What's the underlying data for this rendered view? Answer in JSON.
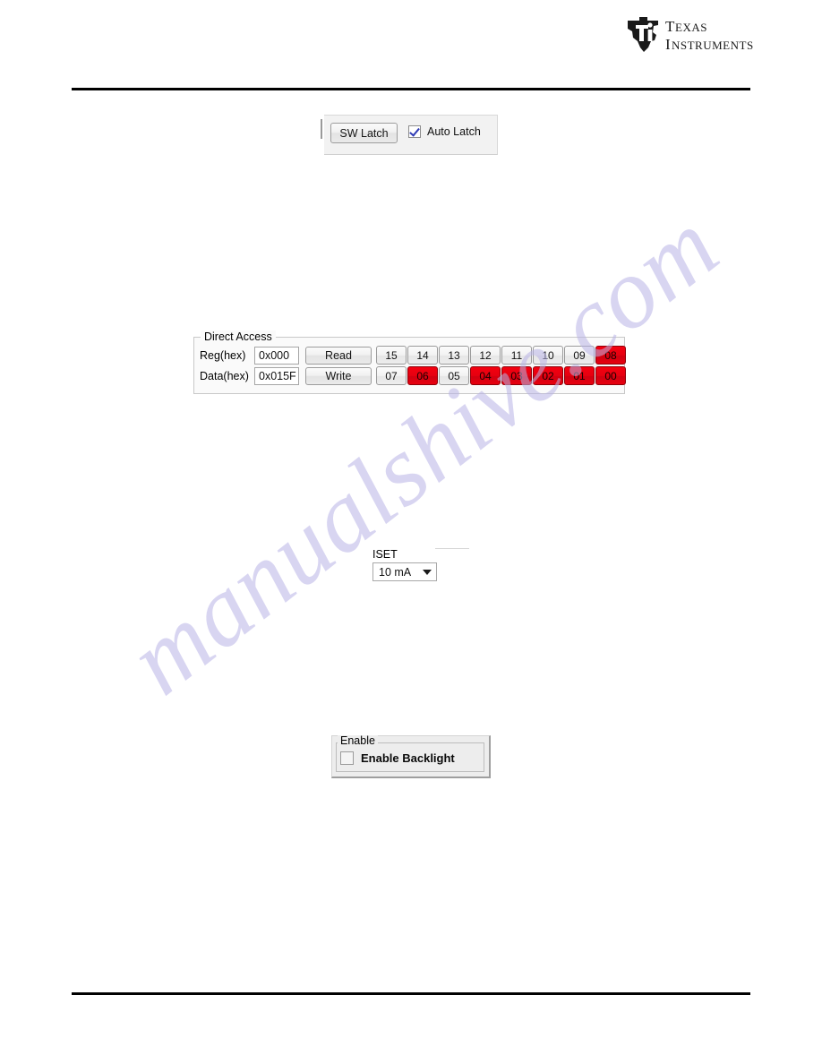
{
  "document": {
    "brand": {
      "logo_name": "texas-instruments-logo",
      "line1": "TEXAS",
      "line2": "INSTRUMENTS"
    },
    "watermark": "manualshive.com"
  },
  "latch_panel": {
    "sw_latch_button": "SW Latch",
    "auto_latch_label": "Auto Latch",
    "auto_latch_checked": true
  },
  "direct_access": {
    "title": "Direct Access",
    "reg_label": "Reg(hex)",
    "reg_value": "0x000",
    "data_label": "Data(hex)",
    "data_value": "0x015F",
    "read_button": "Read",
    "write_button": "Write",
    "bits": [
      {
        "label": "15",
        "state": "off"
      },
      {
        "label": "14",
        "state": "off"
      },
      {
        "label": "13",
        "state": "off"
      },
      {
        "label": "12",
        "state": "off"
      },
      {
        "label": "11",
        "state": "off"
      },
      {
        "label": "10",
        "state": "off"
      },
      {
        "label": "09",
        "state": "off"
      },
      {
        "label": "08",
        "state": "on"
      },
      {
        "label": "07",
        "state": "off"
      },
      {
        "label": "06",
        "state": "on"
      },
      {
        "label": "05",
        "state": "off"
      },
      {
        "label": "04",
        "state": "on"
      },
      {
        "label": "03",
        "state": "on"
      },
      {
        "label": "02",
        "state": "on"
      },
      {
        "label": "01",
        "state": "on"
      },
      {
        "label": "00",
        "state": "on"
      }
    ],
    "colors": {
      "bit_on": "#e8000f",
      "bit_off": "#ededed"
    }
  },
  "iset_panel": {
    "caption": "ISET",
    "selected": "10 mA"
  },
  "enable_panel": {
    "caption": "Enable",
    "checkbox_label": "Enable Backlight",
    "checked": false
  }
}
